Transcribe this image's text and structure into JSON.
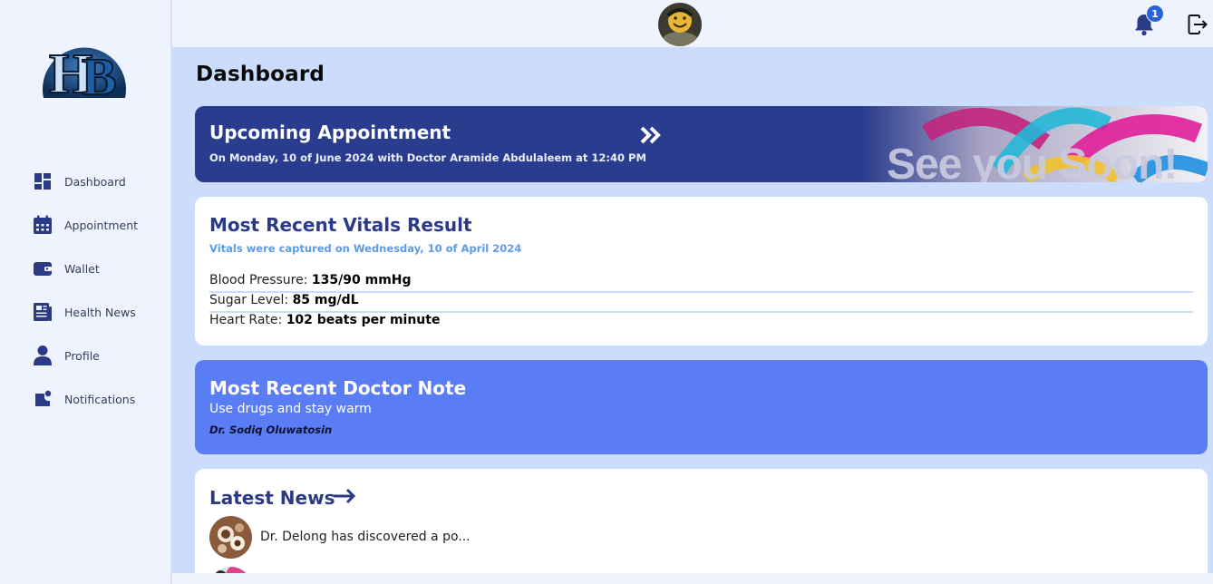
{
  "app": {
    "logo_alt": "HB"
  },
  "sidebar": {
    "items": [
      {
        "label": "Dashboard",
        "icon": "dashboard-icon"
      },
      {
        "label": "Appointment",
        "icon": "calendar-icon"
      },
      {
        "label": "Wallet",
        "icon": "wallet-icon"
      },
      {
        "label": "Health News",
        "icon": "newspaper-icon"
      },
      {
        "label": "Profile",
        "icon": "user-icon"
      },
      {
        "label": "Notifications",
        "icon": "notification-icon"
      }
    ]
  },
  "topbar": {
    "notification_count": "1"
  },
  "page": {
    "title": "Dashboard"
  },
  "appointment": {
    "title": "Upcoming Appointment",
    "subtitle": "On Monday, 10 of June 2024 with Doctor Aramide Abdulaleem at 12:40 PM",
    "banner_text": "See you Soon!"
  },
  "vitals": {
    "title": "Most Recent Vitals Result",
    "subtitle": "Vitals were captured on Wednesday, 10 of April 2024",
    "rows": [
      {
        "label": "Blood Pressure: ",
        "value": "135/90 mmHg"
      },
      {
        "label": "Sugar Level: ",
        "value": "85 mg/dL"
      },
      {
        "label": "Heart Rate: ",
        "value": "102 beats per minute"
      }
    ]
  },
  "doctor_note": {
    "title": "Most Recent Doctor Note",
    "text": "Use drugs and stay warm",
    "doctor": "Dr. Sodiq Oluwatosin"
  },
  "news": {
    "title": "Latest News",
    "items": [
      {
        "text": "Dr. Delong has discovered a po..."
      }
    ]
  },
  "colors": {
    "primary_dark": "#2a3c8e",
    "accent": "#5a7cf5",
    "background": "#ccdcfc",
    "sidebar": "#eef3fe"
  }
}
